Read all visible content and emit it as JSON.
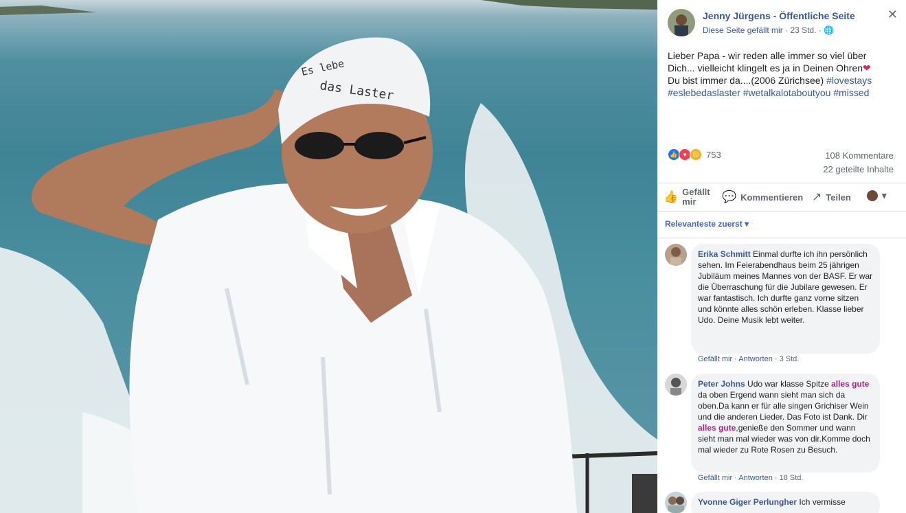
{
  "post": {
    "page_name": "Jenny Jürgens - Öffentliche Seite",
    "liked_label": "Diese Seite gefällt mir",
    "time": "23 Std.",
    "text_lines": [
      "Lieber Papa - wir reden alle immer so viel über",
      "Dich... vielleicht klingelt es ja in Deinen Ohren",
      "Du bist immer da....(2006 Zürichsee)",
      "#eslebedaslaster #wetalkalotaboutyou #missed"
    ],
    "hashtag_inline": "#lovestays",
    "reaction_count": "753",
    "comments_count": "108 Kommentare",
    "shares_count": "22 geteilte Inhalte"
  },
  "cap_text": {
    "line1": "Es lebe",
    "line2": "das Laster"
  },
  "actions": {
    "like": "Gefällt mir",
    "comment": "Kommentieren",
    "share": "Teilen"
  },
  "sort_label": "Relevanteste zuerst",
  "comments": [
    {
      "author": "Erika Schmitt",
      "text": "Einmal durfte ich ihn persönlich sehen. Im Feierabendhaus beim 25 jährigen Jubiläum meines Mannes von der BASF. Er war die Überraschung für die Jubilare gewesen. Er war fantastisch. Ich durfte ganz vorne sitzen und könnte alles schön erleben. Klasse lieber Udo. Deine Musik lebt weiter.",
      "like": "Gefällt mir",
      "reply": "Antworten",
      "time": "3 Std."
    },
    {
      "author": "Peter Johns",
      "text_a": "Udo war klasse Spitze",
      "hl_a": "alles gute",
      "text_b": "da oben Ergend wann sieht man sich da oben.Da kann er für alle singen Grichiser Wein und die anderen Lieder. Das Foto ist Dank. Dir",
      "hl_b": "alles gute",
      "text_c": ",genieße den Sommer und wann sieht man mal wieder was von dir.Komme doch mal wieder zu Rote Rosen zu Besuch.",
      "like": "Gefällt mir",
      "reply": "Antworten",
      "time": "18 Std."
    },
    {
      "author": "Yvonne Giger Perlungher",
      "text": "Ich vermisse"
    }
  ],
  "colors": {
    "link": "#385898",
    "highlight": "#b01f88",
    "heart": "#e0245e"
  }
}
